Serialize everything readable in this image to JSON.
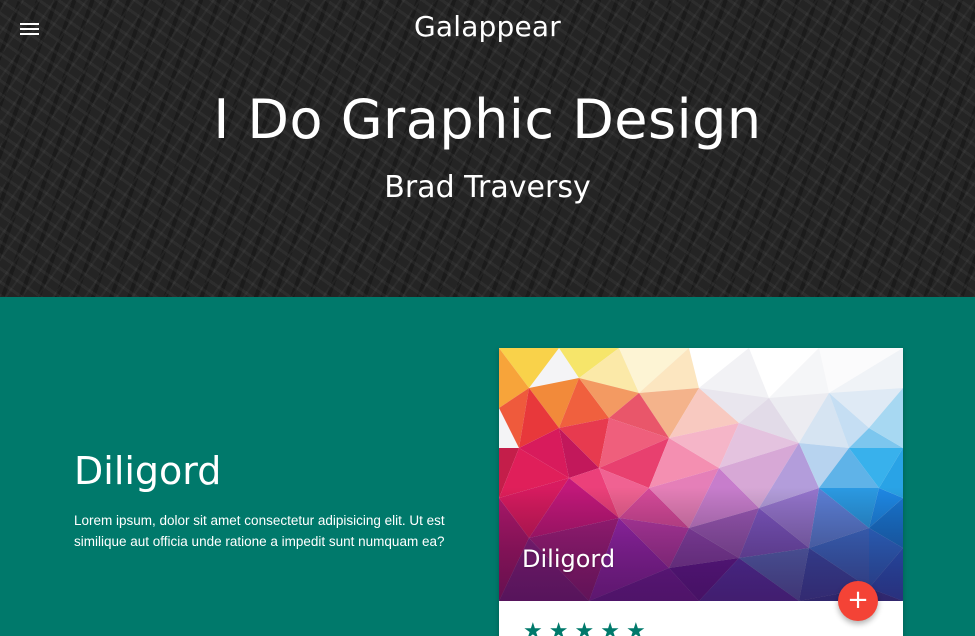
{
  "nav": {
    "menu_icon": "hamburger-menu-icon",
    "brand": "Galappear"
  },
  "hero": {
    "title": "I Do Graphic Design",
    "subtitle": "Brad Traversy"
  },
  "section": {
    "title": "Diligord",
    "text": "Lorem ipsum, dolor sit amet consectetur adipisicing elit. Ut est similique aut officia unde ratione a impedit sunt numquam ea?"
  },
  "card": {
    "title": "Diligord",
    "fab_symbol": "+",
    "fab_icon": "plus-icon",
    "rating": {
      "filled": 5,
      "max": 5,
      "star_glyph": "★"
    }
  },
  "colors": {
    "teal": "#00796b",
    "fab": "#f44336",
    "hero_bg": "#242424"
  }
}
